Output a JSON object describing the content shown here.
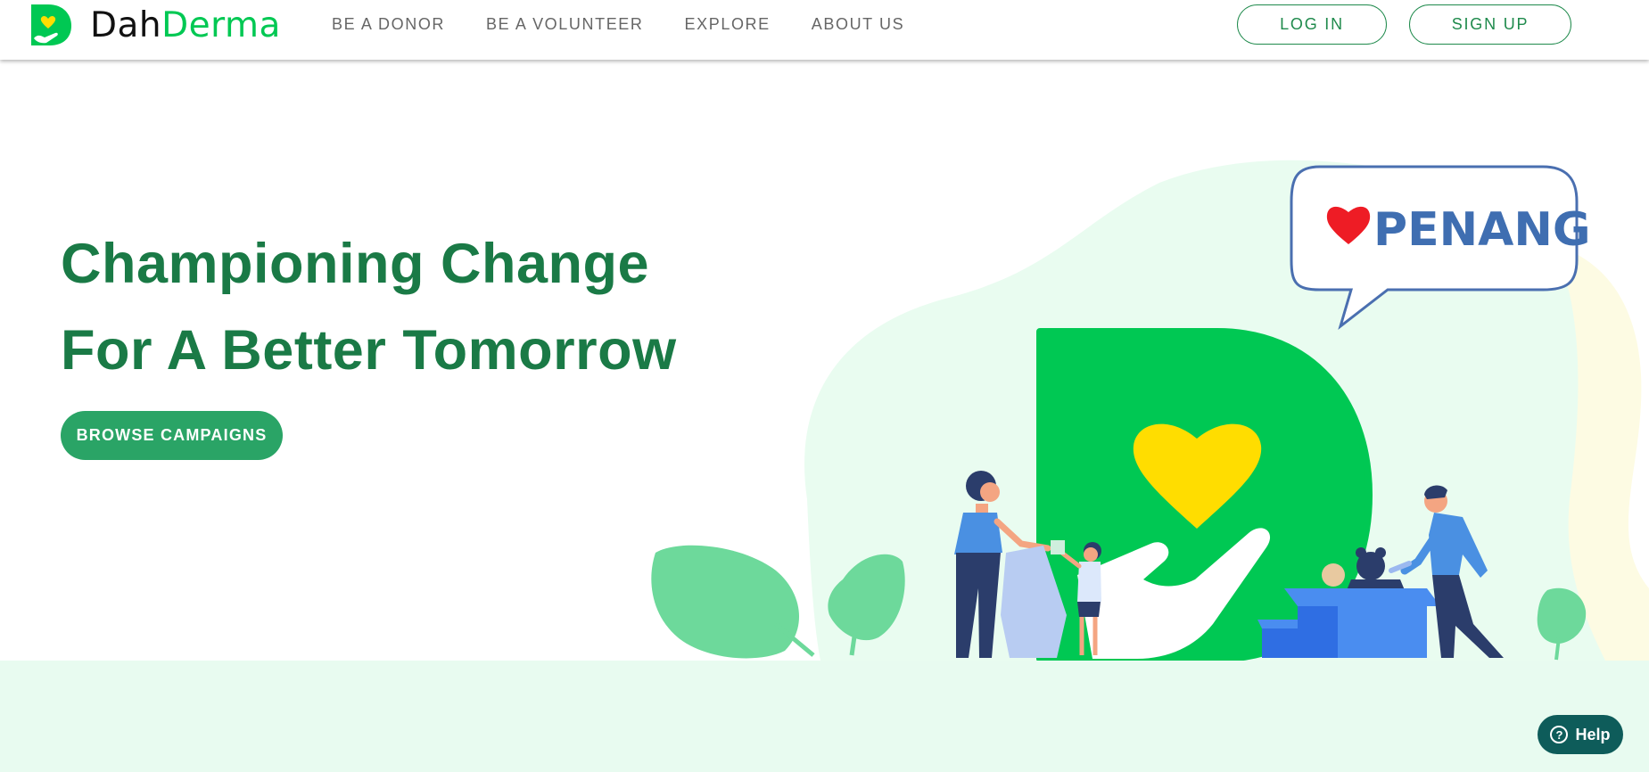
{
  "header": {
    "logo": {
      "part1": "Dah",
      "part2": "Derma"
    },
    "nav": [
      {
        "label": "BE A DONOR"
      },
      {
        "label": "BE A VOLUNTEER"
      },
      {
        "label": "EXPLORE"
      },
      {
        "label": "ABOUT US"
      }
    ],
    "login_label": "LOG IN",
    "signup_label": "SIGN UP"
  },
  "hero": {
    "title_line1": "Championing Change",
    "title_line2": "For A Better Tomorrow",
    "cta_label": "BROWSE CAMPAIGNS",
    "speech_bubble_text": "PENANG"
  },
  "help": {
    "icon": "?",
    "label": "Help"
  },
  "colors": {
    "brand_green": "#00c853",
    "heading_green": "#1a7a46",
    "button_green": "#2aa466",
    "accent_yellow": "#ffdd00",
    "help_teal": "#0e5c5a",
    "mint_background": "#e8fbf0"
  }
}
